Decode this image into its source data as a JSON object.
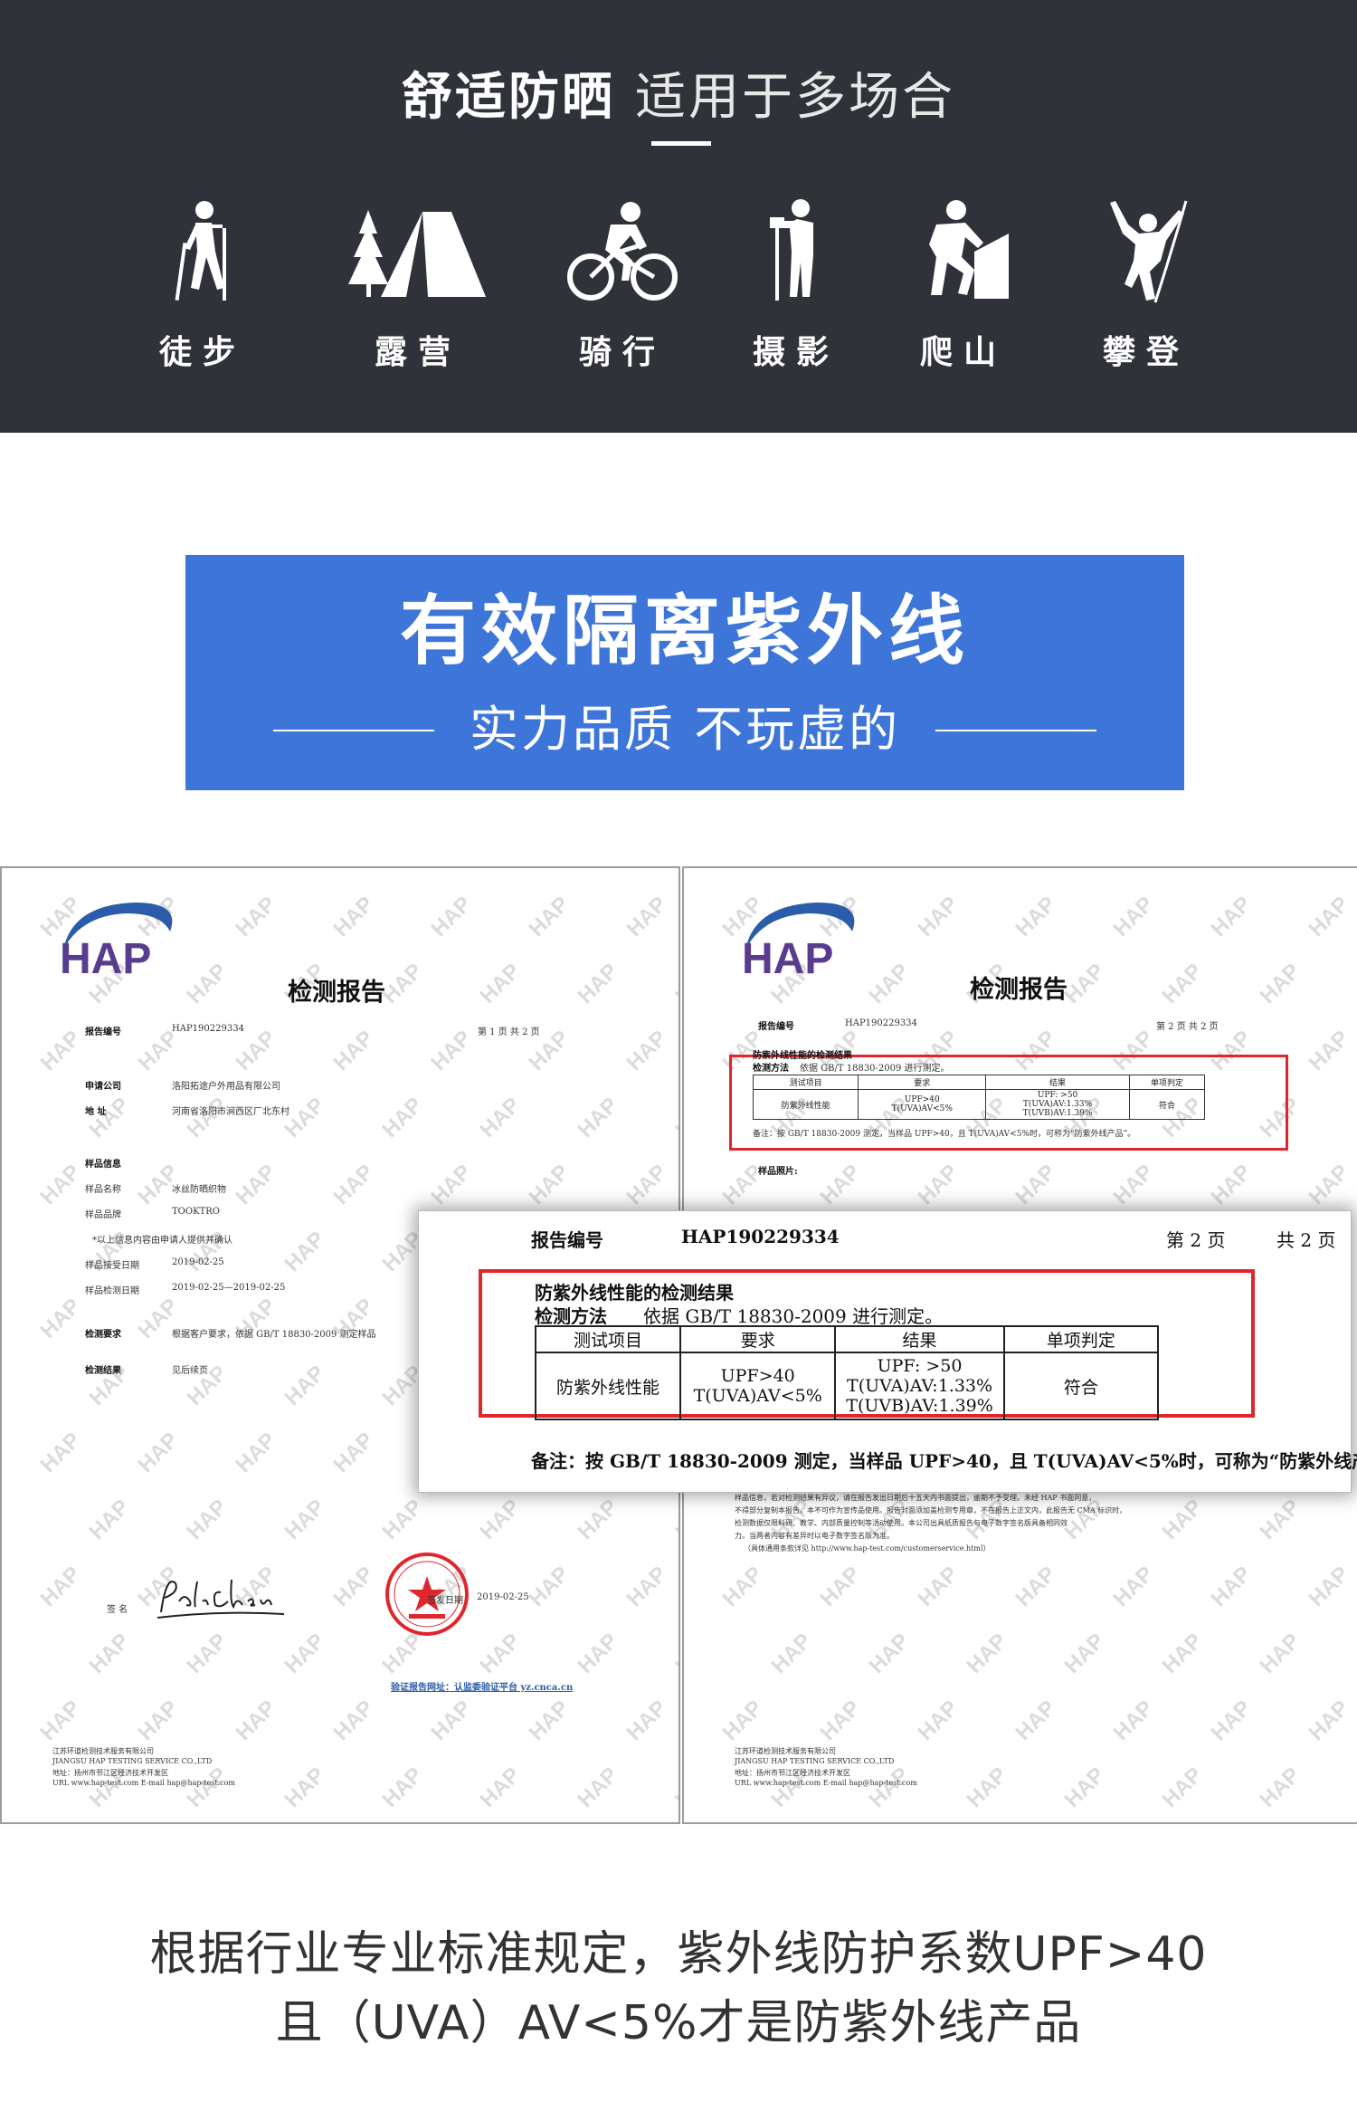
{
  "header": {
    "title_bold": "舒适防晒",
    "title_light": "适用于多场合",
    "activities": [
      {
        "label": "徒步",
        "icon": "hiking-icon"
      },
      {
        "label": "露营",
        "icon": "camping-tent-icon"
      },
      {
        "label": "骑行",
        "icon": "cycling-icon"
      },
      {
        "label": "摄影",
        "icon": "photography-icon"
      },
      {
        "label": "爬山",
        "icon": "mountain-climbing-icon"
      },
      {
        "label": "攀登",
        "icon": "rock-climbing-icon"
      }
    ]
  },
  "banner": {
    "title": "有效隔离紫外线",
    "subtitle": "实力品质 不玩虚的"
  },
  "report_left": {
    "logo": "HAP",
    "heading": "检测报告",
    "report_no_label": "报告编号",
    "report_no": "HAP190229334",
    "page": "第 1 页   共 2 页",
    "rows": [
      {
        "label": "申请公司",
        "value": "洛阳拓途户外用品有限公司"
      },
      {
        "label": "地    址",
        "value": "河南省洛阳市涧西区厂北东村"
      },
      {
        "label": "样品信息",
        "value": ""
      },
      {
        "label": "样品名称",
        "value": "冰丝防晒织物"
      },
      {
        "label": "样品品牌",
        "value": "TOOKTRO"
      },
      {
        "label": "*以上信息内容由申请人提供并确认",
        "value": ""
      },
      {
        "label": "样品接受日期",
        "value": "2019-02-25"
      },
      {
        "label": "样品检测日期",
        "value": "2019-02-25—2019-02-25"
      },
      {
        "label": "检测要求",
        "value": "根据客户要求，依据 GB/T 18830-2009 测定样品"
      },
      {
        "label": "检测结果",
        "value": "见后续页"
      }
    ],
    "sign_label": "签  名",
    "signature": "Paul. Chen",
    "date_label": "签发日期",
    "date": "2019-02-25",
    "verify": "验证报告网址：认监委验证平台 yz.cnca.cn",
    "footer_lines": [
      "江苏环道检测技术服务有限公司",
      "JIANGSU HAP TESTING SERVICE CO.,LTD",
      "地址：扬州市邗江区经济技术开发区",
      "URL www.hap-test.com   E-mail hap@hap-test.com"
    ]
  },
  "report_right": {
    "logo": "HAP",
    "heading": "检测报告",
    "report_no_label": "报告编号",
    "report_no": "HAP190229334",
    "page": "第 2 页   共 2 页",
    "sample_photo_label": "样品照片:",
    "notes": [
      "样品信息，若对检测结果有异议，请在报告发出日期后十五天内书面提出，逾期不予受理。未经 HAP 书面同意，",
      "不得部分复制本报告。本不可作为宣传品使用。报告封面须加盖检测专用章，不在报告上正文内，此报告无 CMA 标识时，",
      "检测数据仅限科研、教学、内部质量控制等活动使用。本公司出具纸质报告与电子数字签名版具备相同效",
      "力。当两者内容有差异时以电子数字签名版为准。",
      "（具体通用条款详见 http://www.hap-test.com/customerservice.html）"
    ],
    "footer_lines": [
      "江苏环道检测技术服务有限公司",
      "JIANGSU HAP TESTING SERVICE CO.,LTD",
      "地址：扬州市邗江区经济技术开发区",
      "URL www.hap-test.com   E-mail hap@hap-test.com"
    ]
  },
  "zoom": {
    "report_no_label": "报告编号",
    "report_no": "HAP190229334",
    "page": "第 2 页",
    "total": "共 2 页",
    "section_title": "防紫外线性能的检测结果",
    "method_label": "检测方法",
    "method": "依据 GB/T 18830-2009 进行测定。",
    "table": {
      "headers": [
        "测试项目",
        "要求",
        "结果",
        "单项判定"
      ],
      "item": "防紫外线性能",
      "req1": "UPF>40",
      "req2": "T(UVA)AV<5%",
      "res1": "UPF:  >50",
      "res2": "T(UVA)AV:1.33%",
      "res3": "T(UVB)AV:1.39%",
      "verdict": "符合"
    },
    "note": "备注：按 GB/T 18830-2009 测定，当样品 UPF>40，且 T(UVA)AV<5%时，可称为“防紫外线产品”。"
  },
  "caption": {
    "line1": "根据行业专业标准规定，紫外线防护系数UPF>40",
    "line2": "且（UVA）AV<5%才是防紫外线产品"
  },
  "colors": {
    "dark_band": "#30323a",
    "blue_banner": "#3d76d8",
    "hap_blue": "#2a5caa",
    "hap_purple": "#5a3c8f",
    "highlight_red": "#e0262d"
  }
}
